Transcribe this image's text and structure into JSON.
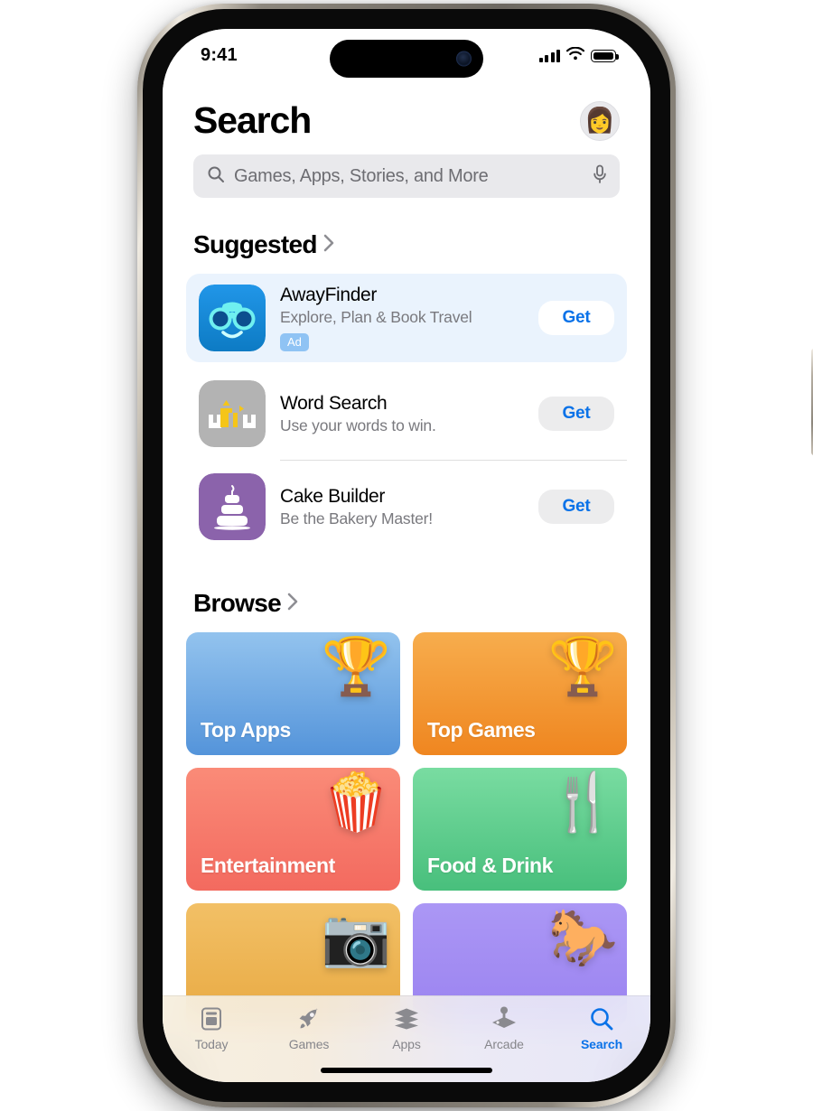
{
  "status_bar": {
    "time": "9:41",
    "cellular_icon": "signal-bars-icon",
    "wifi_icon": "wifi-icon",
    "battery_icon": "battery-icon"
  },
  "header": {
    "title": "Search",
    "avatar_icon": "memoji-avatar",
    "avatar_glyph": "👩"
  },
  "search": {
    "placeholder": "Games, Apps, Stories, and More",
    "search_icon": "search-icon",
    "mic_icon": "microphone-icon"
  },
  "suggested": {
    "title": "Suggested",
    "chevron_icon": "chevron-right-icon",
    "ad_app": {
      "name": "AwayFinder",
      "subtitle": "Explore, Plan & Book Travel",
      "badge": "Ad",
      "action": "Get",
      "icon_name": "binoculars-app-icon"
    },
    "apps": [
      {
        "name": "Word Search",
        "subtitle": "Use your words to win.",
        "action": "Get",
        "icon_name": "word-search-app-icon"
      },
      {
        "name": "Cake Builder",
        "subtitle": "Be the Bakery Master!",
        "action": "Get",
        "icon_name": "cake-app-icon"
      }
    ]
  },
  "browse": {
    "title": "Browse",
    "chevron_icon": "chevron-right-icon",
    "tiles": [
      {
        "label": "Top Apps",
        "art": "🏆",
        "icon_name": "podium-star-icon"
      },
      {
        "label": "Top Games",
        "art": "🏆",
        "icon_name": "podium-star-icon"
      },
      {
        "label": "Entertainment",
        "art": "🍿",
        "icon_name": "popcorn-icon"
      },
      {
        "label": "Food & Drink",
        "art": "🍴",
        "icon_name": "fork-knife-cup-icon"
      },
      {
        "label": "",
        "art": "📷",
        "icon_name": "camera-icon"
      },
      {
        "label": "",
        "art": "🐎",
        "icon_name": "horse-icon"
      }
    ]
  },
  "tabbar": {
    "tabs": [
      {
        "label": "Today",
        "icon_name": "today-newspaper-icon",
        "active": false
      },
      {
        "label": "Games",
        "icon_name": "rocket-icon",
        "active": false
      },
      {
        "label": "Apps",
        "icon_name": "app-stack-icon",
        "active": false
      },
      {
        "label": "Arcade",
        "icon_name": "joystick-icon",
        "active": false
      },
      {
        "label": "Search",
        "icon_name": "search-icon",
        "active": true
      }
    ]
  },
  "colors": {
    "accent_blue": "#0a72e8",
    "ad_card_bg": "#eaf3fd",
    "ad_badge": "#8fc3f4",
    "field_bg": "#e9e9ec",
    "tile_top_apps": "#5e9fe0",
    "tile_top_games": "#f2962f",
    "tile_entertainment": "#f77b6c",
    "tile_food_drink": "#5ec98c",
    "tile_camera": "#eeb458",
    "tile_horse": "#a18bf0"
  }
}
